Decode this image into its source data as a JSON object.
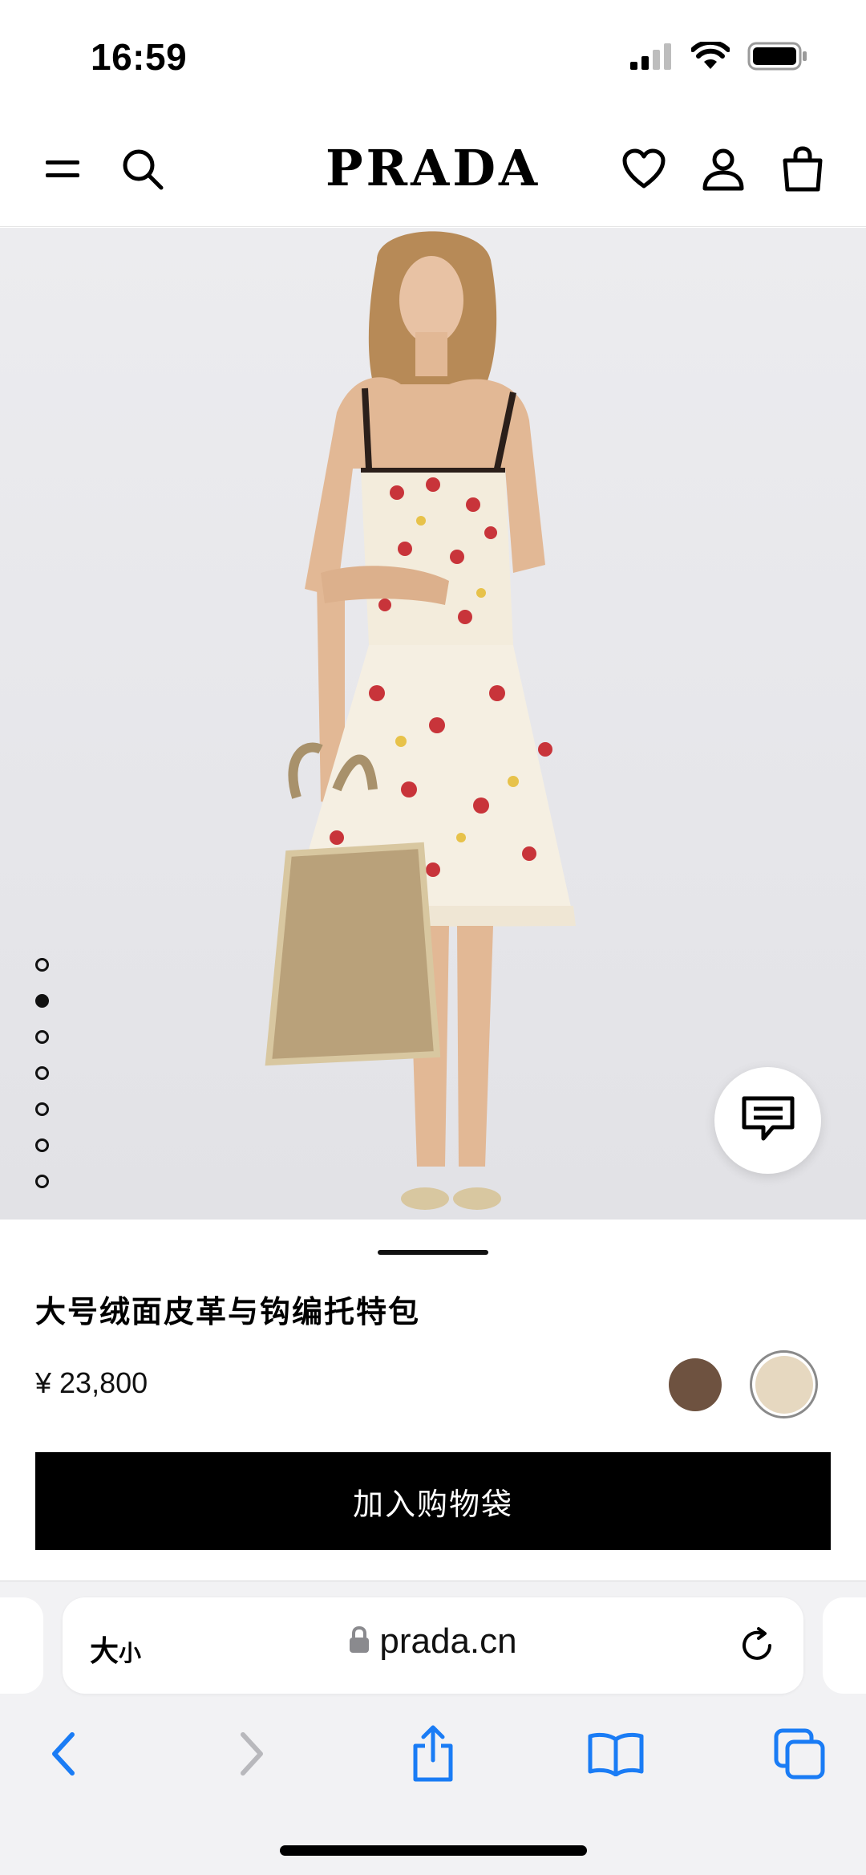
{
  "status_bar": {
    "time": "16:59",
    "icons": [
      "cellular-signal-icon",
      "wifi-icon",
      "battery-icon"
    ]
  },
  "header": {
    "brand": "PRADA",
    "left_icons": [
      "menu-icon",
      "search-icon"
    ],
    "right_icons": [
      "heart-icon",
      "account-icon",
      "shopping-bag-icon"
    ]
  },
  "hero": {
    "image_alt": "Model in floral slip dress holding large suede crochet tote",
    "slide_count": 7,
    "active_slide": 2,
    "chat_icon": "chat-icon"
  },
  "product": {
    "name": "大号绒面皮革与钩编托特包",
    "price": "¥ 23,800",
    "colors": [
      "#6e5240",
      "#e6d8c0"
    ],
    "selected_color_index": 1,
    "add_to_bag_label": "加入购物袋"
  },
  "browser": {
    "text_size_label": "大",
    "text_size_small": "小",
    "url": "prada.cn",
    "toolbar_icons": [
      "back-icon",
      "forward-icon",
      "share-icon",
      "bookmarks-icon",
      "tabs-icon"
    ]
  },
  "colors": {
    "accent_blue": "#1a7cf5",
    "button_black": "#000000"
  }
}
